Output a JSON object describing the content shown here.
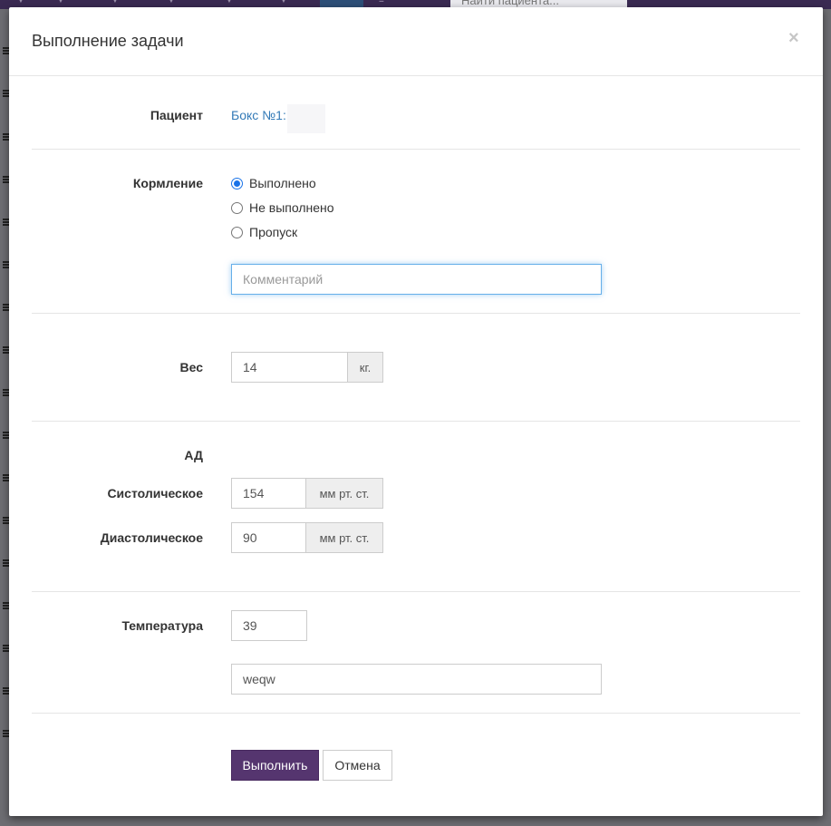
{
  "backdrop": {
    "search_placeholder": "Найти пациента..."
  },
  "modal": {
    "title": "Выполнение задачи",
    "close_label": "×"
  },
  "patient": {
    "label": "Пациент",
    "value": "Бокс №1:"
  },
  "feeding": {
    "label": "Кормление",
    "options": [
      "Выполнено",
      "Не выполнено",
      "Пропуск"
    ],
    "selected": "Выполнено",
    "comment_placeholder": "Комментарий",
    "comment_value": ""
  },
  "weight": {
    "label": "Вес",
    "value": "14",
    "unit": "кг."
  },
  "bp": {
    "label": "АД",
    "systolic_label": "Систолическое",
    "systolic_value": "154",
    "diastolic_label": "Диастолическое",
    "diastolic_value": "90",
    "unit": "мм рт. ст."
  },
  "temperature": {
    "label": "Температура",
    "value": "39",
    "note_value": "weqw"
  },
  "actions": {
    "submit_label": "Выполнить",
    "cancel_label": "Отмена"
  },
  "colors": {
    "primary_button": "#55356f",
    "link": "#337ab7",
    "radio_checked": "#1a73e8",
    "topbar": "#3a2a52"
  }
}
